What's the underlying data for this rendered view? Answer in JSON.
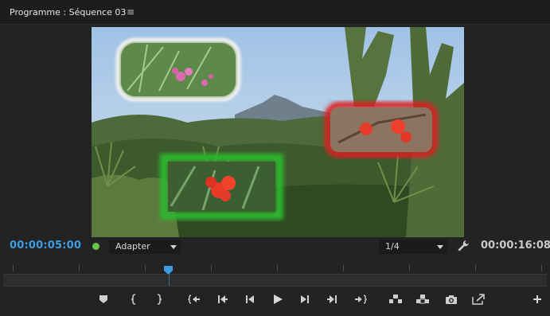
{
  "panel": {
    "title": "Programme : Séquence 03",
    "menu_icon": "hamburger-icon"
  },
  "playback": {
    "current_timecode": "00:00:05:00",
    "duration_timecode": "00:00:16:08",
    "zoom_label": "Adapter",
    "resolution_label": "1/4"
  },
  "colors": {
    "accent": "#3c9de0",
    "status_dot": "#69c24b",
    "inset_red_border": "#d92020",
    "inset_green_border": "#2fb52f",
    "inset_white_border": "#f2f2f2"
  },
  "controls": [
    {
      "name": "add-marker-button",
      "icon": "marker-icon"
    },
    {
      "name": "mark-in-button",
      "icon": "mark-in-icon"
    },
    {
      "name": "mark-out-button",
      "icon": "mark-out-icon"
    },
    {
      "name": "go-to-in-button",
      "icon": "go-to-in-icon"
    },
    {
      "name": "step-back-edit-button",
      "icon": "step-back-edit-icon"
    },
    {
      "name": "step-back-button",
      "icon": "step-back-frame-icon"
    },
    {
      "name": "play-button",
      "icon": "play-icon"
    },
    {
      "name": "step-forward-button",
      "icon": "step-forward-frame-icon"
    },
    {
      "name": "step-forward-edit-button",
      "icon": "step-forward-edit-icon"
    },
    {
      "name": "go-to-out-button",
      "icon": "go-to-out-icon"
    },
    {
      "name": "lift-button",
      "icon": "lift-icon"
    },
    {
      "name": "extract-button",
      "icon": "extract-icon"
    },
    {
      "name": "export-frame-button",
      "icon": "camera-icon"
    },
    {
      "name": "comparison-view-button",
      "icon": "comparison-view-icon"
    },
    {
      "name": "button-editor-button",
      "icon": "plus-icon"
    }
  ]
}
